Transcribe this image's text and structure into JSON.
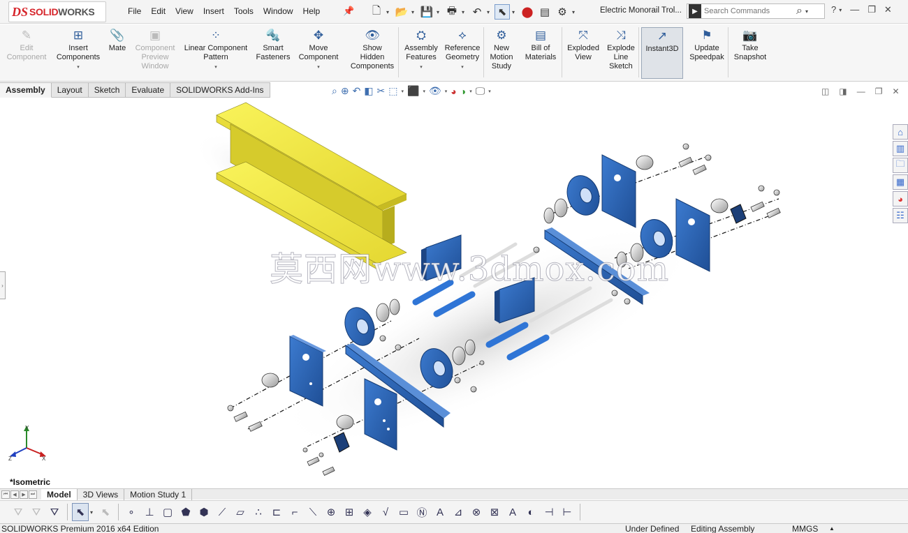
{
  "app": {
    "logo_ds": "DS",
    "logo_solid": "SOLID",
    "logo_works": "WORKS"
  },
  "menu": [
    "File",
    "Edit",
    "View",
    "Insert",
    "Tools",
    "Window",
    "Help"
  ],
  "document_title": "Electric Monorail Trol...",
  "search": {
    "placeholder": "Search Commands"
  },
  "ribbon": [
    {
      "label": "Edit Component",
      "lines": [
        "Edit",
        "Component"
      ],
      "icon": "edit-component-icon",
      "disabled": true
    },
    {
      "label": "Insert Components",
      "lines": [
        "Insert",
        "Components"
      ],
      "icon": "insert-components-icon",
      "dropdown": true
    },
    {
      "label": "Mate",
      "lines": [
        "Mate"
      ],
      "icon": "mate-icon"
    },
    {
      "label": "Component Preview Window",
      "lines": [
        "Component",
        "Preview",
        "Window"
      ],
      "icon": "component-preview-icon",
      "disabled": true
    },
    {
      "label": "Linear Component Pattern",
      "lines": [
        "Linear Component",
        "Pattern"
      ],
      "icon": "linear-pattern-icon",
      "dropdown": true
    },
    {
      "label": "Smart Fasteners",
      "lines": [
        "Smart",
        "Fasteners"
      ],
      "icon": "smart-fasteners-icon"
    },
    {
      "label": "Move Component",
      "lines": [
        "Move",
        "Component"
      ],
      "icon": "move-component-icon",
      "dropdown": true
    },
    {
      "label": "Show Hidden Components",
      "lines": [
        "Show",
        "Hidden",
        "Components"
      ],
      "icon": "show-hidden-icon"
    },
    {
      "label": "Assembly Features",
      "lines": [
        "Assembly",
        "Features"
      ],
      "icon": "assembly-features-icon",
      "dropdown": true
    },
    {
      "label": "Reference Geometry",
      "lines": [
        "Reference",
        "Geometry"
      ],
      "icon": "reference-geometry-icon",
      "dropdown": true
    },
    {
      "label": "New Motion Study",
      "lines": [
        "New",
        "Motion",
        "Study"
      ],
      "icon": "motion-study-icon"
    },
    {
      "label": "Bill of Materials",
      "lines": [
        "Bill of",
        "Materials"
      ],
      "icon": "bom-icon"
    },
    {
      "label": "Exploded View",
      "lines": [
        "Exploded",
        "View"
      ],
      "icon": "exploded-view-icon"
    },
    {
      "label": "Explode Line Sketch",
      "lines": [
        "Explode",
        "Line",
        "Sketch"
      ],
      "icon": "explode-line-icon"
    },
    {
      "label": "Instant3D",
      "lines": [
        "Instant3D"
      ],
      "icon": "instant3d-icon",
      "active": true
    },
    {
      "label": "Update Speedpak",
      "lines": [
        "Update",
        "Speedpak"
      ],
      "icon": "speedpak-icon"
    },
    {
      "label": "Take Snapshot",
      "lines": [
        "Take",
        "Snapshot"
      ],
      "icon": "snapshot-icon"
    }
  ],
  "command_tabs": [
    "Assembly",
    "Layout",
    "Sketch",
    "Evaluate",
    "SOLIDWORKS Add-Ins"
  ],
  "view": {
    "name": "*Isometric",
    "watermark": "莫西网www.3dmox.com"
  },
  "triad": {
    "x": "X",
    "y": "Y",
    "z": "Z"
  },
  "bottom_tabs": [
    "Model",
    "3D Views",
    "Motion Study 1"
  ],
  "status": {
    "product": "SOLIDWORKS Premium 2016 x64 Edition",
    "definition": "Under Defined",
    "mode": "Editing Assembly",
    "units": "MMGS",
    "units_arrow": "▲"
  },
  "colors": {
    "beam": "#f2e643",
    "part": "#2f67b8",
    "accent": "#d6242a"
  }
}
